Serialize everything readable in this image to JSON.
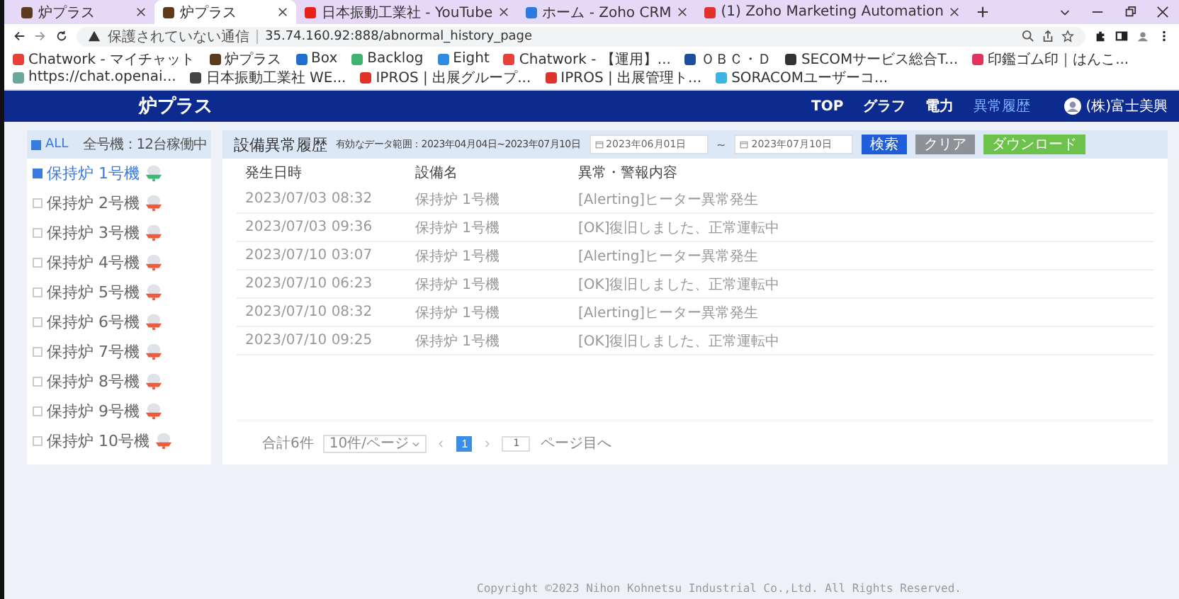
{
  "browser": {
    "tabs": [
      {
        "title": "炉プラス",
        "selected": false,
        "color": "#5b3a1e"
      },
      {
        "title": "炉プラス",
        "selected": true,
        "color": "#5b3a1e"
      },
      {
        "title": "日本振動工業社 - YouTube",
        "selected": false,
        "color": "#e62117"
      },
      {
        "title": "ホーム - Zoho CRM",
        "selected": false,
        "color": "#2a7ae2"
      },
      {
        "title": "(1) Zoho Marketing Automation",
        "selected": false,
        "color": "#e0322b"
      }
    ],
    "security_label": "保護されていない通信",
    "url": "35.74.160.92:888/abnormal_history_page",
    "bookmarks": [
      {
        "label": "Chatwork - マイチャット",
        "color": "#e8413a"
      },
      {
        "label": "炉プラス",
        "color": "#5b3a1e"
      },
      {
        "label": "Box",
        "color": "#1f6fd1"
      },
      {
        "label": "Backlog",
        "color": "#3fb36f"
      },
      {
        "label": "Eight",
        "color": "#2d8be0"
      },
      {
        "label": "Chatwork - 【運用】...",
        "color": "#e8413a"
      },
      {
        "label": "ＯＢＣ・Ｄ",
        "color": "#1f4f9c"
      },
      {
        "label": "SECOMサービス総合T...",
        "color": "#333333"
      },
      {
        "label": "印鑑ゴム印｜はんこ...",
        "color": "#e0335e"
      },
      {
        "label": "https://chat.openai...",
        "color": "#6aa89a"
      },
      {
        "label": "日本振動工業社 WE...",
        "color": "#444444"
      },
      {
        "label": "IPROS | 出展グループ...",
        "color": "#e0322b"
      },
      {
        "label": "IPROS | 出展管理ト...",
        "color": "#e0322b"
      },
      {
        "label": "SORACOMユーザーコ...",
        "color": "#3ab4e0"
      }
    ]
  },
  "header": {
    "logo": "炉プラス",
    "nav": [
      {
        "label": "TOP",
        "selected": false
      },
      {
        "label": "グラフ",
        "selected": false
      },
      {
        "label": "電力",
        "selected": false
      },
      {
        "label": "異常履歴",
        "selected": true
      }
    ],
    "user": "(株)富士美興"
  },
  "sidebar": {
    "all_label": "ALL",
    "summary": "全号機：12台稼働中",
    "items": [
      {
        "name": "保持炉 1号機",
        "selected": true,
        "color": "#3cb878"
      },
      {
        "name": "保持炉 2号機",
        "selected": false,
        "color": "#f05a3a"
      },
      {
        "name": "保持炉 3号機",
        "selected": false,
        "color": "#f05a3a"
      },
      {
        "name": "保持炉 4号機",
        "selected": false,
        "color": "#f05a3a"
      },
      {
        "name": "保持炉 5号機",
        "selected": false,
        "color": "#f05a3a"
      },
      {
        "name": "保持炉 6号機",
        "selected": false,
        "color": "#f05a3a"
      },
      {
        "name": "保持炉 7号機",
        "selected": false,
        "color": "#f05a3a"
      },
      {
        "name": "保持炉 8号機",
        "selected": false,
        "color": "#f05a3a"
      },
      {
        "name": "保持炉 9号機",
        "selected": false,
        "color": "#f05a3a"
      },
      {
        "name": "保持炉 10号機",
        "selected": false,
        "color": "#f05a3a"
      }
    ]
  },
  "toolbar": {
    "title": "設備異常履歴",
    "range": "有効なデータ範囲：2023年04月04日~2023年07月10日",
    "date_from": "2023年06月01日",
    "separator": "~",
    "date_to": "2023年07月10日",
    "buttons": [
      "検索",
      "クリア",
      "ダウンロード"
    ]
  },
  "table": {
    "columns": [
      "発生日時",
      "設備名",
      "異常・警報内容"
    ],
    "rows": [
      [
        "2023/07/03 08:32",
        "保持炉 1号機",
        "[Alerting]ヒーター異常発生"
      ],
      [
        "2023/07/03 09:36",
        "保持炉 1号機",
        "[OK]復旧しました、正常運転中"
      ],
      [
        "2023/07/10 03:07",
        "保持炉 1号機",
        "[Alerting]ヒーター異常発生"
      ],
      [
        "2023/07/10 06:23",
        "保持炉 1号機",
        "[OK]復旧しました、正常運転中"
      ],
      [
        "2023/07/10 08:32",
        "保持炉 1号機",
        "[Alerting]ヒーター異常発生"
      ],
      [
        "2023/07/10 09:25",
        "保持炉 1号機",
        "[OK]復旧しました、正常運転中"
      ]
    ]
  },
  "pagination": {
    "total": "合計6件",
    "page_size": "10件/ページ",
    "pages": [
      {
        "label": "1",
        "selected": true
      }
    ],
    "jump_value": "1",
    "jump_suffix": "ページ目へ"
  },
  "footer": "Copyright ©2023 Nihon Kohnetsu Industrial Co.,Ltd. All Rights Reserved."
}
